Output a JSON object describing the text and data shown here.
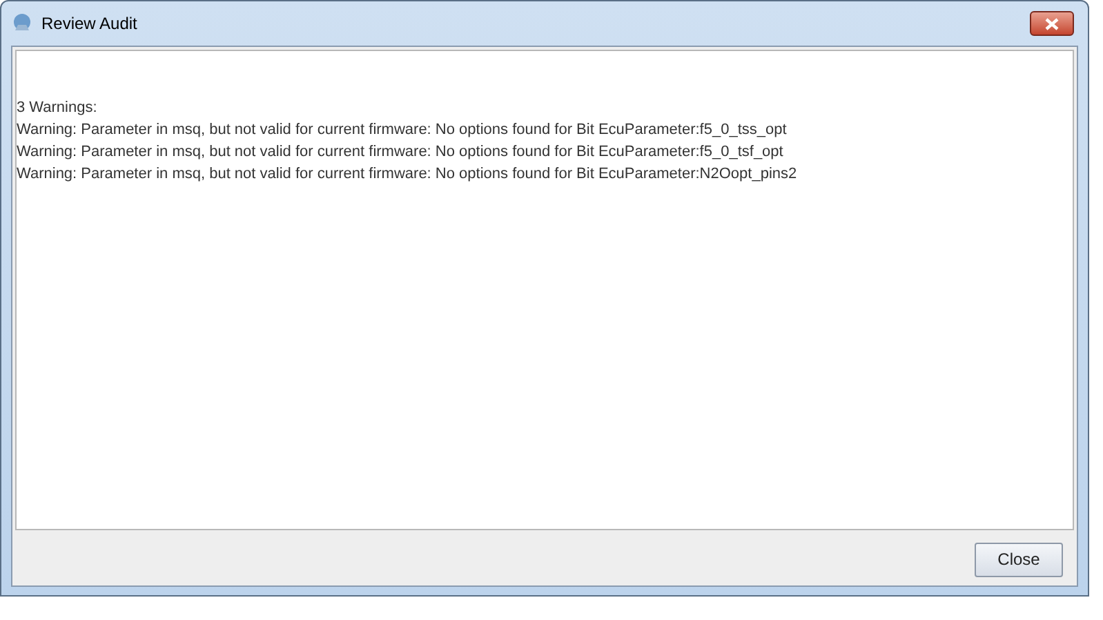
{
  "window": {
    "title": "Review Audit"
  },
  "report": {
    "lines": [
      "3 Warnings:",
      "Warning: Parameter in msq, but not valid for current firmware: No options found for Bit EcuParameter:f5_0_tss_opt",
      "Warning: Parameter in msq, but not valid for current firmware: No options found for Bit EcuParameter:f5_0_tsf_opt",
      "Warning: Parameter in msq, but not valid for current firmware: No options found for Bit EcuParameter:N2Oopt_pins2"
    ]
  },
  "buttons": [
    {
      "label": "Close"
    }
  ]
}
